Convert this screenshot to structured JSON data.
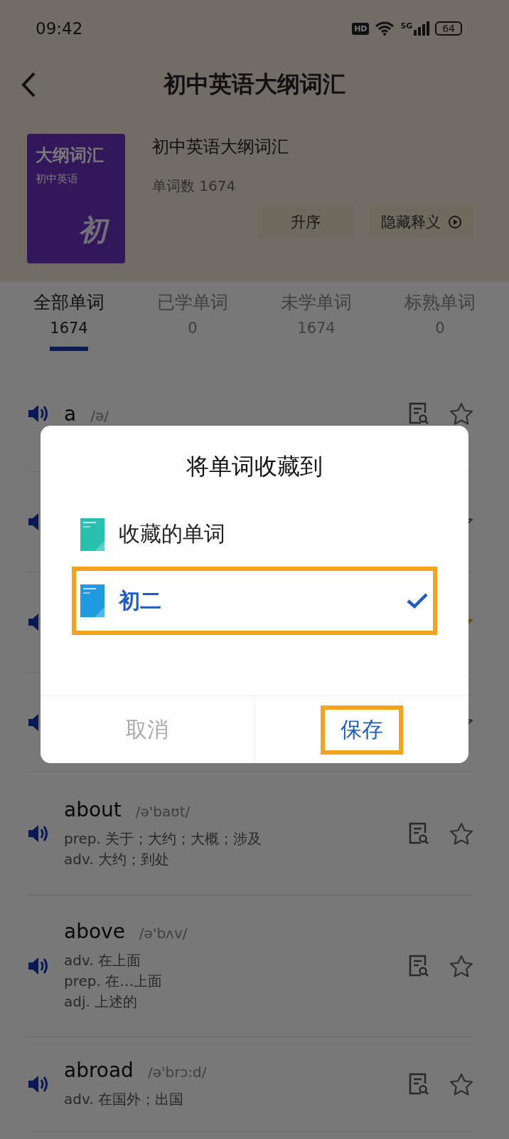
{
  "status_bar": {
    "time": "09:42",
    "hd": "HD",
    "network": "5G",
    "battery": "64"
  },
  "header": {
    "title": "初中英语大纲词汇"
  },
  "book": {
    "cover_title": "大纲词汇",
    "cover_subtitle": "初中英语",
    "cover_mark": "初",
    "name": "初中英语大纲词汇",
    "word_count": "单词数 1674",
    "buttons": [
      {
        "label": "升序",
        "kind": "plain"
      },
      {
        "label": "隐藏释义",
        "kind": "play"
      }
    ]
  },
  "tabs": [
    {
      "label": "全部单词",
      "count": "1674",
      "selected": true
    },
    {
      "label": "已学单词",
      "count": "0",
      "selected": false
    },
    {
      "label": "未学单词",
      "count": "1674",
      "selected": false
    },
    {
      "label": "标熟单词",
      "count": "0",
      "selected": false
    }
  ],
  "words": [
    {
      "word": "a",
      "phonetic": "/ə/",
      "starred": false
    },
    {
      "starred": false
    },
    {
      "starred": true
    },
    {
      "starred": false
    },
    {
      "word": "about",
      "phonetic": "/ə'baʊt/",
      "definitions": [
        "prep. 关于；大约；大概；涉及",
        "adv. 大约；到处"
      ],
      "starred": false
    },
    {
      "word": "above",
      "phonetic": "/ə'bʌv/",
      "definitions": [
        "adv. 在上面",
        "prep. 在…上面",
        "adj. 上述的"
      ],
      "starred": false
    },
    {
      "word": "abroad",
      "phonetic": "/ə'brɔ:d/",
      "definitions": [
        "adv. 在国外；出国"
      ],
      "starred": false
    }
  ],
  "dialog": {
    "title": "将单词收藏到",
    "items": [
      {
        "label": "收藏的单词",
        "color": "#2bbfae",
        "selected": false,
        "highlighted": false
      },
      {
        "label": "初二",
        "color": "#1e9be0",
        "selected": true,
        "highlighted": true
      }
    ],
    "buttons": [
      {
        "label": "取消",
        "kind": "cancel",
        "highlighted": false
      },
      {
        "label": "保存",
        "kind": "confirm",
        "highlighted": true
      }
    ]
  }
}
